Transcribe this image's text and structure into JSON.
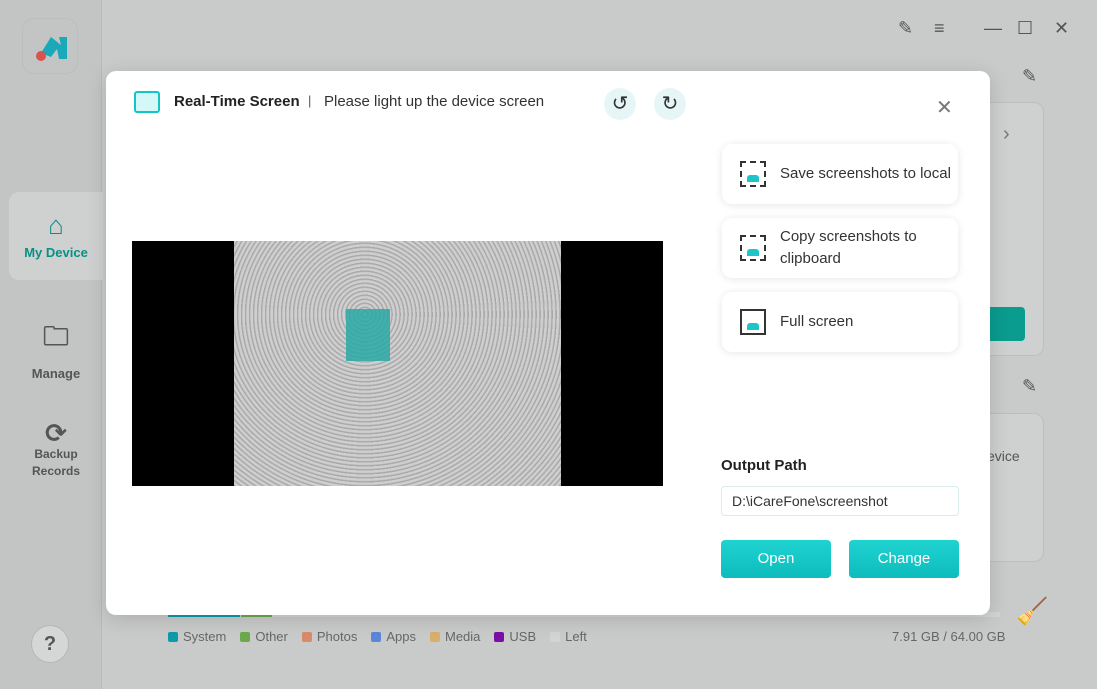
{
  "app": {
    "nav": [
      {
        "label": "My Device",
        "icon": "home-icon"
      },
      {
        "label": "Manage",
        "icon": "folder-icon"
      },
      {
        "label": "Backup Records",
        "icon": "backup-icon"
      }
    ],
    "help": "?",
    "partial_device_text": "evice"
  },
  "storage": {
    "legend": [
      {
        "label": "System",
        "color": "#0e9aa7"
      },
      {
        "label": "Other",
        "color": "#6aaa4c"
      },
      {
        "label": "Photos",
        "color": "#d98a6a"
      },
      {
        "label": "Apps",
        "color": "#5b86d9"
      },
      {
        "label": "Media",
        "color": "#d9b06a"
      },
      {
        "label": "USB",
        "color": "#7a0ea7"
      },
      {
        "label": "Left",
        "color": "#d3d5d4"
      }
    ],
    "usage": "7.91 GB / 64.00 GB",
    "used_fraction": 0.1236
  },
  "modal": {
    "title": "Real-Time Screen",
    "separator": "|",
    "subtitle": "Please light up the device screen",
    "actions": [
      {
        "label": "Save screenshots to local",
        "icon": "save-screenshot-icon"
      },
      {
        "label": "Copy screenshots to clipboard",
        "icon": "copy-screenshot-icon"
      },
      {
        "label": "Full screen",
        "icon": "full-screen-icon"
      }
    ],
    "output_label": "Output Path",
    "output_path": "D:\\iCareFone\\screenshot",
    "open": "Open",
    "change": "Change"
  },
  "colors": {
    "accent": "#12c6c6"
  }
}
